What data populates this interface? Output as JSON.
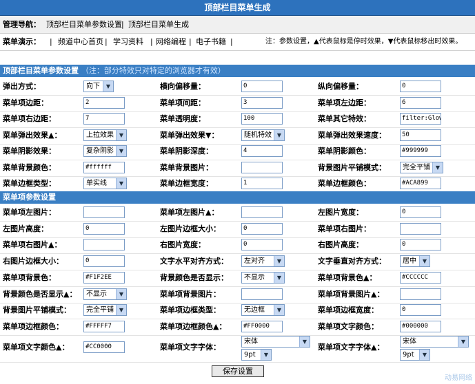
{
  "header": {
    "title": "顶部栏目菜单生成"
  },
  "nav": {
    "label": "管理导航：",
    "links": [
      "顶部栏目菜单参数设置",
      "|",
      "顶部栏目菜单生成"
    ]
  },
  "demo": {
    "label": "菜单演示：",
    "items": [
      "|",
      "频道中心首页",
      "|",
      "学习资料",
      "|",
      "网络编程",
      "|",
      "电子书籍",
      "|"
    ],
    "note": "注：参数设置，▲代表鼠标是停时效果，▼代表鼠标移出时效果。"
  },
  "section1": {
    "title": "顶部栏目菜单参数设置",
    "note": "（注：部分特效只对特定的浏览器才有效）",
    "rows": [
      [
        {
          "label": "弹出方式：",
          "type": "select",
          "value": "向下"
        },
        {
          "label": "横向偏移量：",
          "type": "input",
          "value": "0"
        },
        {
          "label": "纵向偏移量：",
          "type": "input",
          "value": "0"
        }
      ],
      [
        {
          "label": "菜单项边距：",
          "type": "input",
          "value": "2"
        },
        {
          "label": "菜单项间距：",
          "type": "input",
          "value": "3"
        },
        {
          "label": "菜单项左边距：",
          "type": "input",
          "value": "6"
        }
      ],
      [
        {
          "label": "菜单项右边距：",
          "type": "input",
          "value": "7"
        },
        {
          "label": "菜单透明度：",
          "type": "input",
          "value": "100"
        },
        {
          "label": "菜单其它特效：",
          "type": "input",
          "value": "filter:Glow"
        }
      ],
      [
        {
          "label": "菜单弹出效果▲：",
          "type": "select",
          "value": "上拉效果"
        },
        {
          "label": "菜单弹出效果▼：",
          "type": "select",
          "value": "随机特效"
        },
        {
          "label": "菜单弹出效果速度：",
          "type": "input",
          "value": "50"
        }
      ],
      [
        {
          "label": "菜单阴影效果：",
          "type": "select",
          "value": "复杂阴影"
        },
        {
          "label": "菜单阴影深度：",
          "type": "input",
          "value": "4"
        },
        {
          "label": "菜单阴影颜色：",
          "type": "input",
          "value": "#999999"
        }
      ],
      [
        {
          "label": "菜单背景颜色：",
          "type": "input",
          "value": "#ffffff"
        },
        {
          "label": "菜单背景图片：",
          "type": "input",
          "value": ""
        },
        {
          "label": "背景图片平铺模式：",
          "type": "select",
          "value": "完全平铺"
        }
      ],
      [
        {
          "label": "菜单边框类型：",
          "type": "select",
          "value": "单实线"
        },
        {
          "label": "菜单边框宽度：",
          "type": "input",
          "value": "1"
        },
        {
          "label": "菜单边框颜色：",
          "type": "input",
          "value": "#ACA899"
        }
      ]
    ]
  },
  "section2": {
    "title": "菜单项参数设置",
    "rows": [
      [
        {
          "label": "菜单项左图片：",
          "type": "input",
          "value": ""
        },
        {
          "label": "菜单项左图片▲：",
          "type": "input",
          "value": ""
        },
        {
          "label": "左图片宽度：",
          "type": "input",
          "value": "0"
        }
      ],
      [
        {
          "label": "左图片高度：",
          "type": "input",
          "value": "0"
        },
        {
          "label": "左图片边框大小：",
          "type": "input",
          "value": "0"
        },
        {
          "label": "菜单项右图片：",
          "type": "input",
          "value": ""
        }
      ],
      [
        {
          "label": "菜单项右图片▲：",
          "type": "input",
          "value": ""
        },
        {
          "label": "右图片宽度：",
          "type": "input",
          "value": "0"
        },
        {
          "label": "右图片高度：",
          "type": "input",
          "value": "0"
        }
      ],
      [
        {
          "label": "右图片边框大小：",
          "type": "input",
          "value": "0"
        },
        {
          "label": "文字水平对齐方式：",
          "type": "select",
          "value": "左对齐"
        },
        {
          "label": "文字垂直对齐方式：",
          "type": "select",
          "value": "居中"
        }
      ],
      [
        {
          "label": "菜单项背景色：",
          "type": "input",
          "value": "#F1F2EE"
        },
        {
          "label": "背景颜色是否显示：",
          "type": "select",
          "value": "不显示"
        },
        {
          "label": "菜单项背景色▲：",
          "type": "input",
          "value": "#CCCCCC"
        }
      ],
      [
        {
          "label": "背景颜色是否显示▲：",
          "type": "select",
          "value": "不显示"
        },
        {
          "label": "菜单项背景图片：",
          "type": "input",
          "value": ""
        },
        {
          "label": "菜单项背景图片▲：",
          "type": "input",
          "value": ""
        }
      ],
      [
        {
          "label": "背景图片平铺模式：",
          "type": "select",
          "value": "完全平铺"
        },
        {
          "label": "菜单项边框类型：",
          "type": "select",
          "value": "无边框"
        },
        {
          "label": "菜单项边框宽度：",
          "type": "input",
          "value": "0"
        }
      ],
      [
        {
          "label": "菜单项边框颜色：",
          "type": "input",
          "value": "#FFFFF7"
        },
        {
          "label": "菜单项边框颜色▲：",
          "type": "input",
          "value": "#FF0000"
        },
        {
          "label": "菜单项文字颜色：",
          "type": "input",
          "value": "#000000"
        }
      ]
    ],
    "last_row": {
      "c1": {
        "label": "菜单项文字颜色▲：",
        "value": "#CC0000"
      },
      "c2": {
        "label": "菜单项文字字体：",
        "font": "宋体",
        "size": "9pt"
      },
      "c3": {
        "label": "菜单项文字字体▲：",
        "font": "宋体",
        "size": "9pt"
      }
    }
  },
  "actions": {
    "save_label": "保存设置"
  },
  "watermark": "动易网络",
  "colors": {
    "title_bar": "#2d72bd",
    "section_header": "#3a7fc4",
    "input_border": "#7a9cc6"
  }
}
